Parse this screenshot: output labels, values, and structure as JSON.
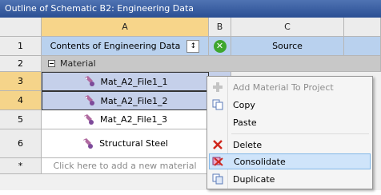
{
  "window": {
    "title": "Outline of Schematic B2: Engineering Data"
  },
  "columns": [
    "A",
    "B",
    "C"
  ],
  "rows": [
    {
      "num": "1",
      "a": "Contents of Engineering Data",
      "c": "Source"
    },
    {
      "num": "2",
      "a": "Material"
    },
    {
      "num": "3",
      "a": "Mat_A2_File1_1"
    },
    {
      "num": "4",
      "a": "Mat_A2_File1_2"
    },
    {
      "num": "5",
      "a": "Mat_A2_File1_3"
    },
    {
      "num": "6",
      "a": "Structural Steel"
    },
    {
      "num": "*",
      "a": "Click here to add a new material"
    }
  ],
  "context_menu": {
    "items": [
      {
        "label": "Add Material To Project",
        "icon": "add-icon",
        "state": "disabled"
      },
      {
        "label": "Copy",
        "icon": "copy-icon",
        "state": "normal"
      },
      {
        "label": "Paste",
        "icon": "",
        "state": "normal"
      },
      {
        "label": "Delete",
        "icon": "delete-x-icon",
        "state": "normal"
      },
      {
        "label": "Consolidate",
        "icon": "consolidate-icon",
        "state": "hover"
      },
      {
        "label": "Duplicate",
        "icon": "duplicate-icon",
        "state": "normal"
      }
    ]
  }
}
